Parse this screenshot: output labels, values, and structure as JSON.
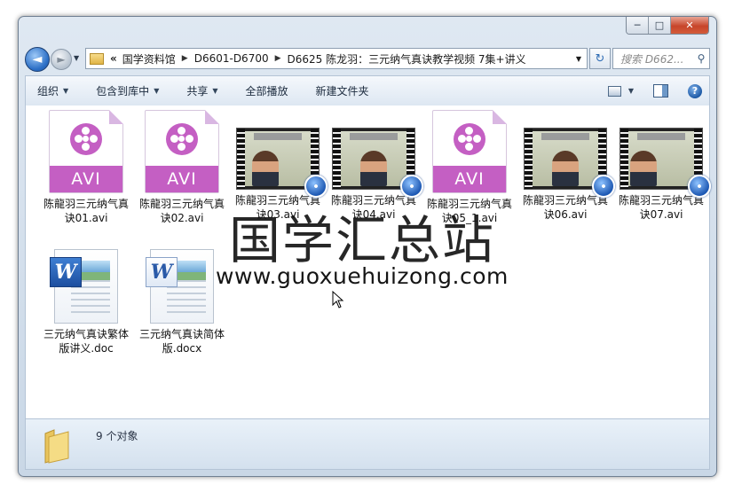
{
  "window": {
    "caption": {
      "minimize": "─",
      "maximize": "□",
      "close": "✕"
    }
  },
  "nav": {
    "back_glyph": "◄",
    "forward_glyph": "►",
    "breadcrumb": [
      "国学资料馆",
      "D6601-D6700",
      "D6625 陈龙羽：三元纳气真诀教学视频 7集+讲义"
    ],
    "overflow": "«",
    "search_placeholder": "搜索 D662...",
    "refresh_glyph": "↻"
  },
  "toolbar": {
    "organize": "组织",
    "include_in_library": "包含到库中",
    "share": "共享",
    "play_all": "全部播放",
    "new_folder": "新建文件夹",
    "help": "?"
  },
  "files": [
    {
      "name": "陈龍羽三元纳气真诀01.avi",
      "kind": "avi",
      "type_label": "AVI"
    },
    {
      "name": "陈龍羽三元纳气真诀02.avi",
      "kind": "avi",
      "type_label": "AVI"
    },
    {
      "name": "陈龍羽三元纳气真诀03.avi",
      "kind": "video"
    },
    {
      "name": "陈龍羽三元纳气真诀04.avi",
      "kind": "video"
    },
    {
      "name": "陈龍羽三元纳气真诀05_1.avi",
      "kind": "avi",
      "type_label": "AVI"
    },
    {
      "name": "陈龍羽三元纳气真诀06.avi",
      "kind": "video"
    },
    {
      "name": "陈龍羽三元纳气真诀07.avi",
      "kind": "video"
    },
    {
      "name": "三元纳气真诀繁体版讲义.doc",
      "kind": "doc"
    },
    {
      "name": "三元纳气真诀简体版.docx",
      "kind": "docx"
    }
  ],
  "watermark": {
    "title": "国学汇总站",
    "url": "www.guoxuehuizong.com"
  },
  "details": {
    "count": "9 个对象"
  },
  "colors": {
    "avi_accent": "#c45fc3",
    "toolbar": "#dde7f2"
  }
}
